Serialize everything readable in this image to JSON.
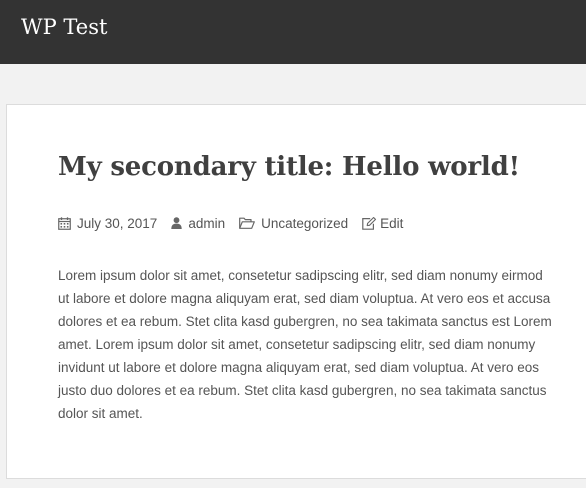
{
  "header": {
    "site_title": "WP Test"
  },
  "post": {
    "title": "My secondary title: Hello world!",
    "meta": {
      "date": "July 30, 2017",
      "author": "admin",
      "category": "Uncategorized",
      "edit_label": "Edit"
    },
    "body_lines": [
      "Lorem ipsum dolor sit amet, consetetur sadipscing elitr, sed diam nonumy eirmod",
      "ut labore et dolore magna aliquyam erat, sed diam voluptua. At vero eos et accusa",
      "dolores et ea rebum. Stet clita kasd gubergren, no sea takimata sanctus est Lorem",
      "amet. Lorem ipsum dolor sit amet, consetetur sadipscing elitr, sed diam nonumy",
      "invidunt ut labore et dolore magna aliquyam erat, sed diam voluptua. At vero eos",
      "justo duo dolores et ea rebum. Stet clita kasd gubergren, no sea takimata sanctus",
      "dolor sit amet."
    ]
  },
  "colors": {
    "header_bg": "#333333",
    "page_bg": "#f2f2f2",
    "card_bg": "#ffffff",
    "text": "#555555",
    "title": "#404040"
  },
  "icons": {
    "date": "calendar-icon",
    "author": "user-icon",
    "category": "folder-open-icon",
    "edit": "edit-icon"
  }
}
